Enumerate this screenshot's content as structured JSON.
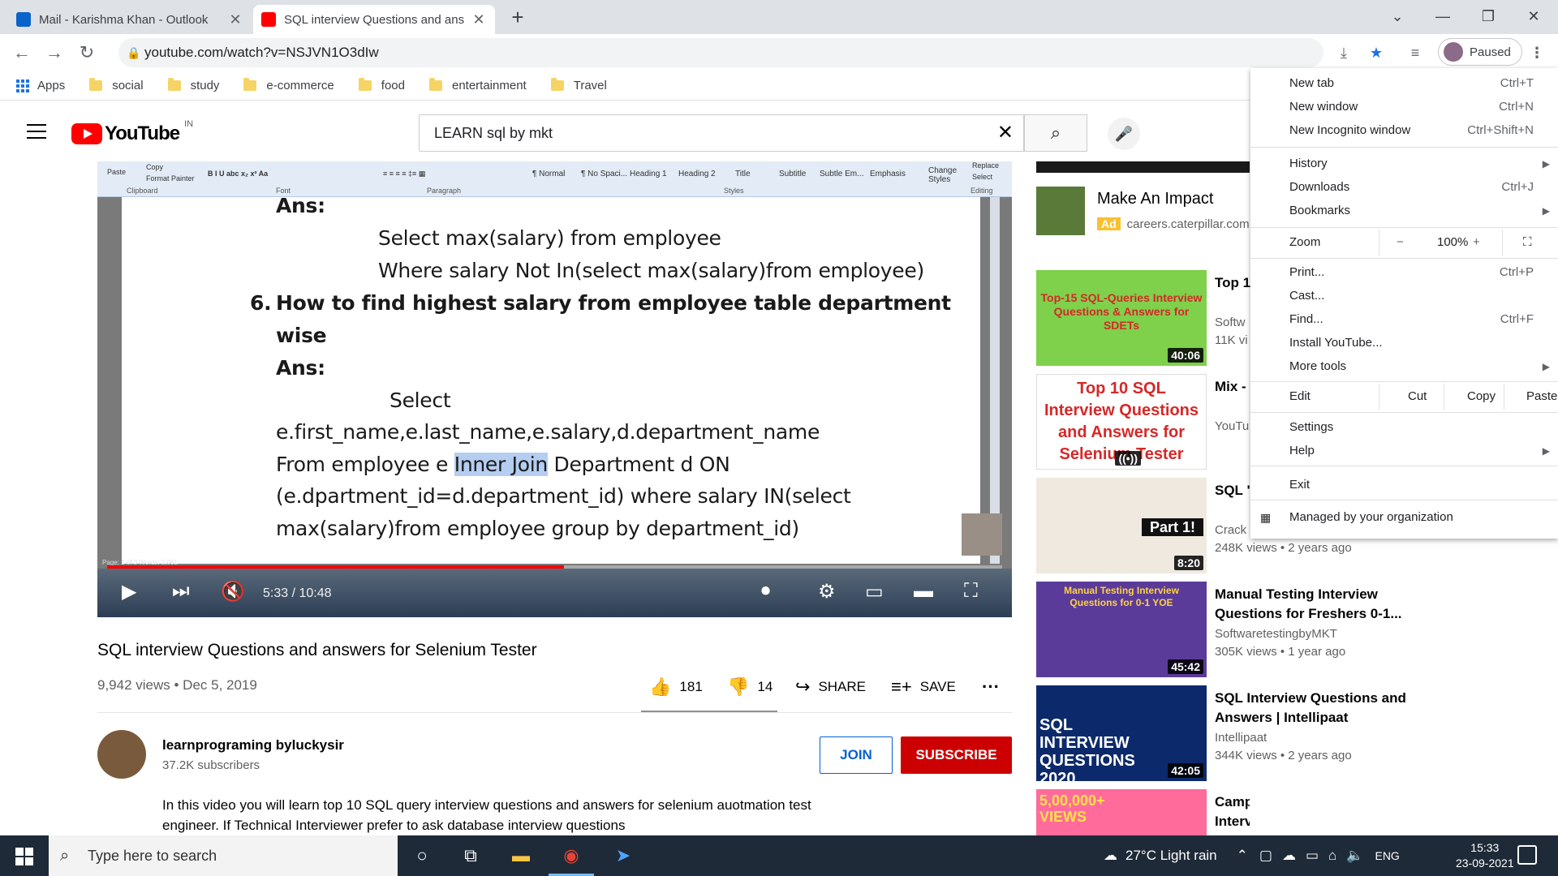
{
  "browser": {
    "tabs": [
      {
        "title": "Mail - Karishma Khan - Outlook",
        "active": false,
        "favicon_color": "#0a63c9"
      },
      {
        "title": "SQL interview Questions and ans",
        "active": true,
        "favicon_color": "#ff0000"
      }
    ],
    "url": "youtube.com/watch?v=NSJVN1O3dIw",
    "profile_label": "Paused",
    "bookmarks": [
      "Apps",
      "social",
      "study",
      "e-commerce",
      "food",
      "entertainment",
      "Travel"
    ]
  },
  "youtube": {
    "logo_text": "YouTube",
    "country": "IN",
    "search_query": "LEARN sql by mkt"
  },
  "video": {
    "word_ribbon": {
      "clipboard_items": [
        "Paste",
        "Copy",
        "Format Painter"
      ],
      "groups": [
        "Clipboard",
        "Font",
        "Paragraph",
        "Styles",
        "Editing"
      ],
      "styles": [
        "¶ Normal",
        "¶ No Spaci...",
        "Heading 1",
        "Heading 2",
        "Title",
        "Subtitle",
        "Subtle Em...",
        "Emphasis",
        "Change Styles"
      ],
      "editing": [
        "Replace",
        "Select"
      ]
    },
    "document_lines": [
      "Ans:",
      "Select  max(salary) from employee",
      "Where salary Not In(select max(salary)from employee)",
      "6.",
      "How to find highest salary from employee table department",
      "wise",
      "Ans:",
      "Select",
      "e.first_name,e.last_name,e.salary,d.department_name",
      "From employee e ",
      "Inner Join",
      " Department d ON",
      "(e.dpartment_id=d.department_id) where salary IN(select",
      "max(salary)from employee group by department_id)"
    ],
    "word_status": {
      "page": "Page: 1 of 3",
      "words": "Words: 2,061"
    },
    "time_current": "5:33",
    "time_total": "10:48",
    "time_display": "5:33 / 10:48",
    "progress": 0.51,
    "title": "SQL interview Questions and answers for Selenium Tester",
    "views": "9,942 views",
    "date": "Dec 5, 2019",
    "meta": "9,942 views • Dec 5, 2019",
    "likes": "181",
    "dislikes": "14",
    "share_label": "SHARE",
    "save_label": "SAVE"
  },
  "channel": {
    "name": "learnprograming byluckysir",
    "subscribers": "37.2K subscribers",
    "join_label": "JOIN",
    "subscribe_label": "SUBSCRIBE",
    "description": "In this video you will learn top 10 SQL query interview questions and answers for selenium auotmation test engineer. If Technical Interviewer prefer to ask database interview questions"
  },
  "sidebar": {
    "ad": {
      "title": "Make An Impact",
      "badge": "Ad",
      "url": "careers.caterpillar.com"
    },
    "recommendations": [
      {
        "title": "Top 1 Ques",
        "channel": "Softw",
        "meta": "11K vi",
        "duration": "40:06",
        "thumb_text": "Top-15 SQL-Queries Interview Questions & Answers for SDETs",
        "thumb_bg": "#7fd04a",
        "thumb_color": "#d62828"
      },
      {
        "title": "Mix - byluc",
        "channel": "YouTu",
        "meta": "",
        "duration": "((•))",
        "thumb_text": "Top 10 SQL Interview Questions and Answers for Selenium Tester",
        "thumb_bg": "#ffffff",
        "thumb_color": "#d62828"
      },
      {
        "title": "SQL \" interv",
        "channel": "Crack",
        "meta": "248K views • 2 years ago",
        "duration": "8:20",
        "thumb_text": "Part 1!",
        "thumb_bg": "#efe9e0",
        "thumb_color": "#222222"
      },
      {
        "title": "Manual Testing Interview Questions for Freshers 0-1...",
        "channel": "SoftwaretestingbyMKT",
        "meta": "305K views • 1 year ago",
        "duration": "45:42",
        "thumb_text": "Manual Testing Interview Questions for 0-1 YOE",
        "thumb_bg": "#5b3b9a",
        "thumb_color": "#ffd23f"
      },
      {
        "title": "SQL Interview Questions and Answers | Intellipaat",
        "channel": "Intellipaat",
        "meta": "344K views • 2 years ago",
        "duration": "42:05",
        "thumb_text": "SQL INTERVIEW QUESTIONS 2020",
        "thumb_bg": "#0c2a6b",
        "thumb_color": "#ffffff"
      },
      {
        "title": "Campus Placement Interviews- Cognizant & Wipr...",
        "channel": "",
        "meta": "",
        "duration": "",
        "thumb_text": "5,00,000+ VIEWS",
        "thumb_bg": "#ff6b9a",
        "thumb_color": "#ffe14d"
      }
    ]
  },
  "chrome_menu": {
    "items": [
      {
        "label": "New tab",
        "shortcut": "Ctrl+T"
      },
      {
        "label": "New window",
        "shortcut": "Ctrl+N"
      },
      {
        "label": "New Incognito window",
        "shortcut": "Ctrl+Shift+N"
      },
      {
        "label": "History",
        "shortcut": ""
      },
      {
        "label": "Downloads",
        "shortcut": "Ctrl+J"
      },
      {
        "label": "Bookmarks",
        "shortcut": ""
      },
      {
        "label": "Print...",
        "shortcut": "Ctrl+P"
      },
      {
        "label": "Cast...",
        "shortcut": ""
      },
      {
        "label": "Find...",
        "shortcut": "Ctrl+F"
      },
      {
        "label": "Install YouTube...",
        "shortcut": ""
      },
      {
        "label": "More tools",
        "shortcut": ""
      },
      {
        "label": "Settings",
        "shortcut": ""
      },
      {
        "label": "Help",
        "shortcut": ""
      },
      {
        "label": "Exit",
        "shortcut": ""
      },
      {
        "label": "Managed by your organization",
        "shortcut": ""
      }
    ],
    "zoom": {
      "label": "Zoom",
      "minus": "−",
      "value": "100%",
      "plus": "+"
    },
    "edit": {
      "label": "Edit",
      "cut": "Cut",
      "copy": "Copy",
      "paste": "Paste"
    }
  },
  "taskbar": {
    "search_placeholder": "Type here to search",
    "weather": "27°C  Light rain",
    "language": "ENG",
    "time": "15:33",
    "date": "23-09-2021"
  }
}
